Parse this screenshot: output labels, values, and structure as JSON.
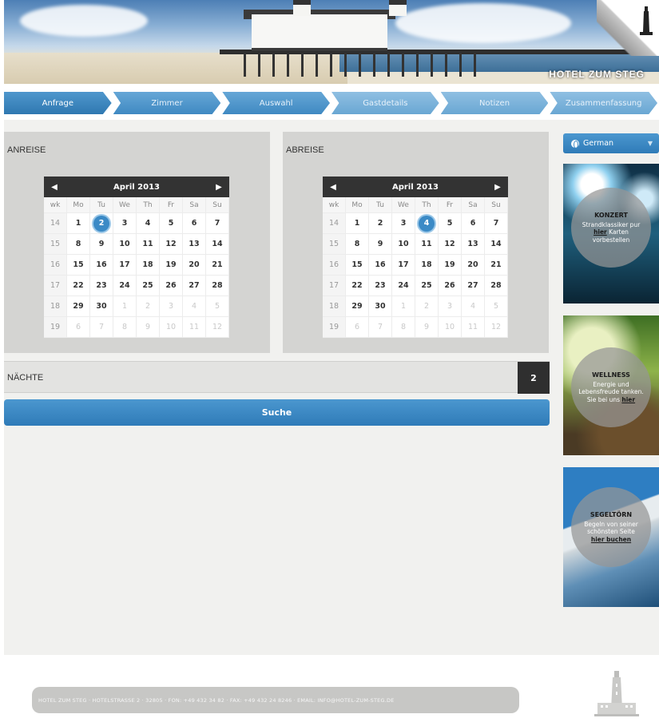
{
  "header": {
    "brand": "HOTEL ZUM STEG"
  },
  "steps": [
    "Anfrage",
    "Zimmer",
    "Auswahl",
    "Gastdetails",
    "Notizen",
    "Zusammenfassung"
  ],
  "arrival": {
    "title": "ANREISE",
    "month": "April 2013",
    "prev": "◀",
    "next": "▶",
    "headers": [
      "wk",
      "Mo",
      "Tu",
      "We",
      "Th",
      "Fr",
      "Sa",
      "Su"
    ],
    "weeks": [
      [
        "14",
        "1",
        "2",
        "3",
        "4",
        "5",
        "6",
        "7"
      ],
      [
        "15",
        "8",
        "9",
        "10",
        "11",
        "12",
        "13",
        "14"
      ],
      [
        "16",
        "15",
        "16",
        "17",
        "18",
        "19",
        "20",
        "21"
      ],
      [
        "17",
        "22",
        "23",
        "24",
        "25",
        "26",
        "27",
        "28"
      ],
      [
        "18",
        "29",
        "30",
        "1",
        "2",
        "3",
        "4",
        "5"
      ],
      [
        "19",
        "6",
        "7",
        "8",
        "9",
        "10",
        "11",
        "12"
      ]
    ],
    "selected_day": "2"
  },
  "departure": {
    "title": "ABREISE",
    "month": "April 2013",
    "prev": "◀",
    "next": "▶",
    "headers": [
      "wk",
      "Mo",
      "Tu",
      "We",
      "Th",
      "Fr",
      "Sa",
      "Su"
    ],
    "weeks": [
      [
        "14",
        "1",
        "2",
        "3",
        "4",
        "5",
        "6",
        "7"
      ],
      [
        "15",
        "8",
        "9",
        "10",
        "11",
        "12",
        "13",
        "14"
      ],
      [
        "16",
        "15",
        "16",
        "17",
        "18",
        "19",
        "20",
        "21"
      ],
      [
        "17",
        "22",
        "23",
        "24",
        "25",
        "26",
        "27",
        "28"
      ],
      [
        "18",
        "29",
        "30",
        "1",
        "2",
        "3",
        "4",
        "5"
      ],
      [
        "19",
        "6",
        "7",
        "8",
        "9",
        "10",
        "11",
        "12"
      ]
    ],
    "selected_day": "4"
  },
  "nights": {
    "label": "NÄCHTE",
    "value": "2"
  },
  "search": {
    "label": "Suche"
  },
  "sidebar": {
    "language": "German",
    "promos": [
      {
        "title": "KONZERT",
        "text": "Strandklassiker pur",
        "link": "hier",
        "link_suffix": "Karten vorbestellen"
      },
      {
        "title": "WELLNESS",
        "text": "Energie und Lebensfreude tanken. Sie bei uns",
        "link": "hier",
        "link_suffix": ""
      },
      {
        "title": "SEGELTÖRN",
        "text": "Begeln von seiner schönsten Seite",
        "link": "hier buchen",
        "link_suffix": ""
      }
    ]
  },
  "footer": {
    "text": "HOTEL ZUM STEG · HOTELSTRASSE 2 · 32805 · FON: +49 432 34 82 · FAX: +49 432 24 8246 · EMAIL: INFO@HOTEL-ZUM-STEG.DE"
  },
  "colors": {
    "accent": "#3b8ac6",
    "dark": "#333333",
    "panel": "#d4d4d2"
  }
}
